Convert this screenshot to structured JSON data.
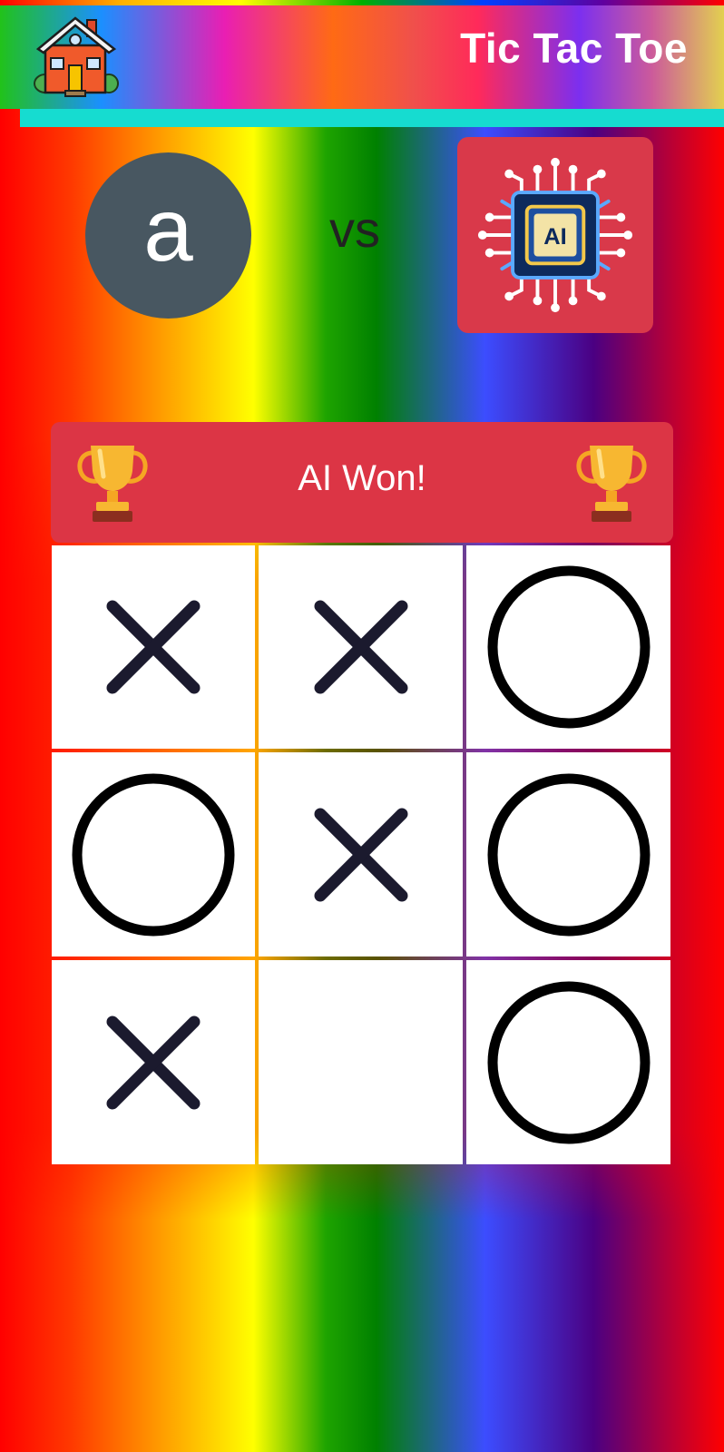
{
  "header": {
    "title": "Tic Tac Toe",
    "home_icon": "house-icon"
  },
  "players": {
    "human": {
      "initial": "a"
    },
    "vs_label": "vs",
    "ai": {
      "icon": "ai-chip-icon",
      "chip_label": "AI"
    }
  },
  "result": {
    "text": "AI Won!",
    "icon": "trophy-icon"
  },
  "board": {
    "cells": [
      "X",
      "X",
      "O",
      "O",
      "X",
      "O",
      "X",
      "",
      "O"
    ]
  },
  "colors": {
    "header_accent": "#16dcd0",
    "banner": "#dc3545",
    "ai_tile": "#d9394a",
    "avatar": "#485761",
    "x_mark": "#1b1a2e",
    "o_mark": "#000000"
  }
}
